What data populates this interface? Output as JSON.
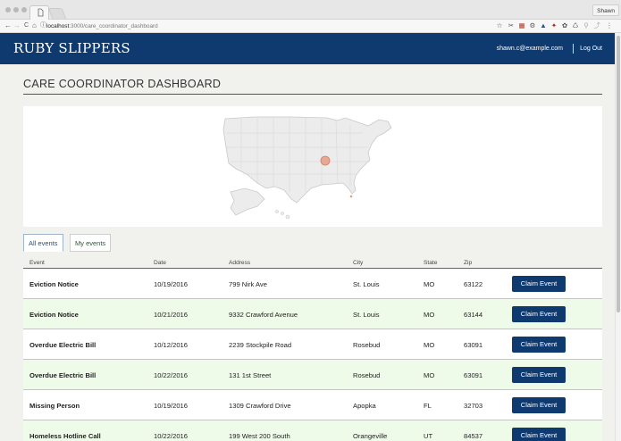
{
  "browser": {
    "profile_name": "Shawn",
    "url_host": "localhost",
    "url_path": ":3000/care_coordinator_dashboard",
    "nav": {
      "back": "←",
      "forward": "→",
      "reload": "C",
      "home": "⌂",
      "info": "ⓘ"
    },
    "extensions": [
      "☆",
      "✂",
      "▦",
      "⚙",
      "▲",
      "✦",
      "✿",
      "♺",
      "⚲",
      "⤴",
      "⋮"
    ]
  },
  "header": {
    "brand": "RUBY SLIPPERS",
    "user_email": "shawn.c@example.com",
    "logout_label": "Log Out"
  },
  "page": {
    "title": "CARE COORDINATOR DASHBOARD"
  },
  "map": {
    "marker_color": "#e29a7e",
    "land_color": "#ececec",
    "border_color": "#c9c9c9"
  },
  "tabs": [
    {
      "label": "All events",
      "active": true
    },
    {
      "label": "My events",
      "active": false
    }
  ],
  "table": {
    "headers": [
      "Event",
      "Date",
      "Address",
      "City",
      "State",
      "Zip"
    ],
    "claim_label": "Claim Event",
    "rows": [
      {
        "event": "Eviction Notice",
        "date": "10/19/2016",
        "address": "799 Nirk Ave",
        "city": "St. Louis",
        "state": "MO",
        "zip": "63122"
      },
      {
        "event": "Eviction Notice",
        "date": "10/21/2016",
        "address": "9332 Crawford Avenue",
        "city": "St. Louis",
        "state": "MO",
        "zip": "63144"
      },
      {
        "event": "Overdue Electric Bill",
        "date": "10/12/2016",
        "address": "2239 Stockpile Road",
        "city": "Rosebud",
        "state": "MO",
        "zip": "63091"
      },
      {
        "event": "Overdue Electric Bill",
        "date": "10/22/2016",
        "address": "131 1st Street",
        "city": "Rosebud",
        "state": "MO",
        "zip": "63091"
      },
      {
        "event": "Missing Person",
        "date": "10/19/2016",
        "address": "1309 Crawford Drive",
        "city": "Apopka",
        "state": "FL",
        "zip": "32703"
      },
      {
        "event": "Homeless Hotline Call",
        "date": "10/22/2016",
        "address": "199 West 200 South",
        "city": "Orangeville",
        "state": "UT",
        "zip": "84537"
      }
    ]
  },
  "colors": {
    "header_bg": "#0f3a70",
    "page_bg": "#f1f2ee",
    "row_alt_bg": "#effbe9",
    "button_bg": "#0f3a70"
  }
}
